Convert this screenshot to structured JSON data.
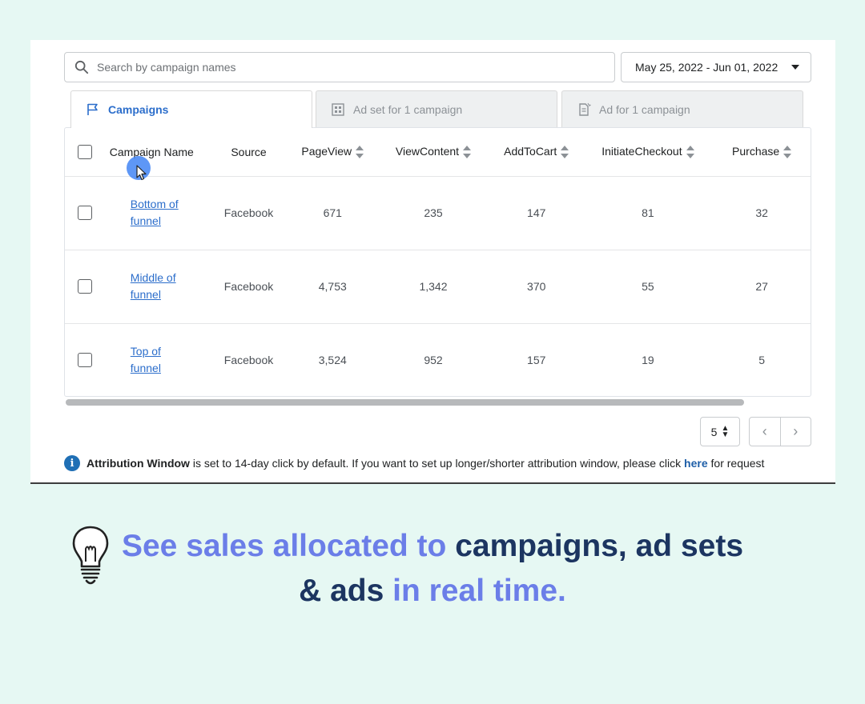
{
  "search": {
    "placeholder": "Search by campaign names"
  },
  "date_range": "May 25, 2022 - Jun 01, 2022",
  "tabs": [
    {
      "label": "Campaigns",
      "icon": "flag-icon",
      "active": true
    },
    {
      "label": "Ad set for 1 campaign",
      "icon": "grid-icon",
      "active": false
    },
    {
      "label": "Ad for 1 campaign",
      "icon": "document-icon",
      "active": false
    }
  ],
  "table": {
    "columns": [
      "Campaign Name",
      "Source",
      "PageView",
      "ViewContent",
      "AddToCart",
      "InitiateCheckout",
      "Purchase"
    ],
    "rows": [
      {
        "name_line1": "Bottom of",
        "name_line2": "funnel",
        "source": "Facebook",
        "pageview": "671",
        "viewcontent": "235",
        "addtocart": "147",
        "initiatecheckout": "81",
        "purchase": "32"
      },
      {
        "name_line1": "Middle of",
        "name_line2": "funnel",
        "source": "Facebook",
        "pageview": "4,753",
        "viewcontent": "1,342",
        "addtocart": "370",
        "initiatecheckout": "55",
        "purchase": "27"
      },
      {
        "name_line1": "Top of",
        "name_line2": "funnel",
        "source": "Facebook",
        "pageview": "3,524",
        "viewcontent": "952",
        "addtocart": "157",
        "initiatecheckout": "19",
        "purchase": "5"
      }
    ]
  },
  "pagination": {
    "per_page": "5",
    "prev": "‹",
    "next": "›"
  },
  "notice": {
    "strong": "Attribution Window",
    "text": " is set to 14-day click by default. If you want to set up longer/shorter attribution window, please click ",
    "link": "here",
    "tail": " for request"
  },
  "headline": {
    "part1": "See sales allocated to ",
    "part2": "campaigns, ad sets",
    "part3": "& ads ",
    "part4": "in real time."
  },
  "colors": {
    "accent": "#2c6ecb",
    "headline_light": "#6b7ee8",
    "headline_dark": "#1c3561",
    "background": "#e6f8f3"
  }
}
